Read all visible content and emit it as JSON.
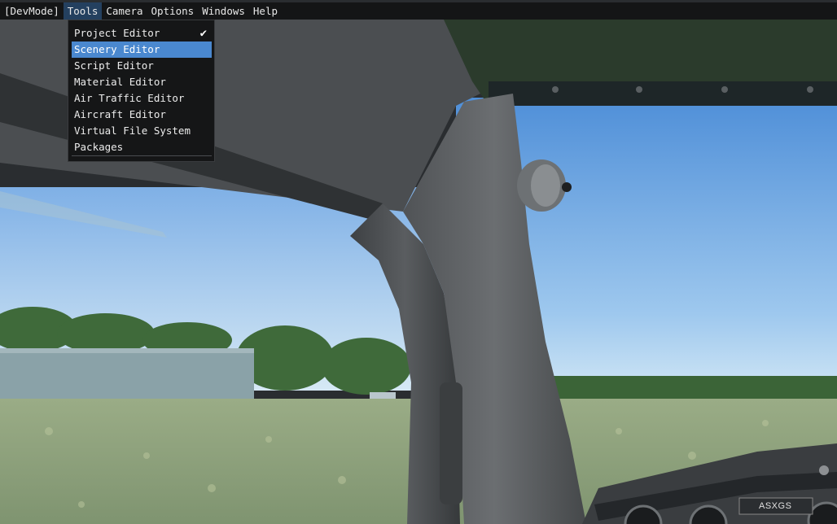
{
  "menubar": {
    "items": [
      {
        "label": "[DevMode]"
      },
      {
        "label": "Tools"
      },
      {
        "label": "Camera"
      },
      {
        "label": "Options"
      },
      {
        "label": "Windows"
      },
      {
        "label": "Help"
      }
    ],
    "active": "Tools"
  },
  "tools_menu": {
    "items": [
      {
        "label": "Project Editor",
        "checked": true
      },
      {
        "label": "Scenery Editor",
        "highlighted": true
      },
      {
        "label": "Script Editor"
      },
      {
        "label": "Material Editor"
      },
      {
        "label": "Air Traffic Editor"
      },
      {
        "label": "Aircraft Editor"
      },
      {
        "label": "Virtual File System"
      },
      {
        "label": "Packages"
      }
    ],
    "checkmark": "✔"
  },
  "scene": {
    "aircraft_registration": "ASXGS",
    "colors": {
      "sky_top": "#5a93d6",
      "sky_horizon": "#d4e8f5",
      "grass": "#8ea07a",
      "cockpit_frame": "#4a4d50",
      "highlight": "#4a88cf"
    }
  }
}
